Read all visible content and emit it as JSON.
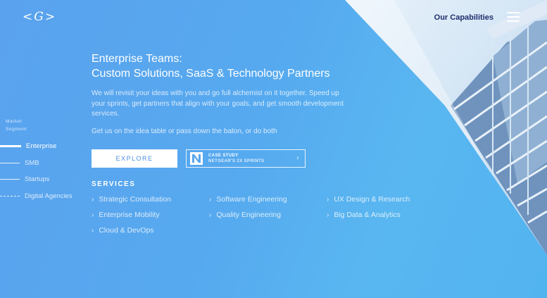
{
  "header": {
    "logo": "<G>",
    "nav_link": "Our Capabilities"
  },
  "segment_nav": {
    "label_line1": "Market",
    "label_line2": "Segment",
    "items": [
      {
        "label": "Enterprise",
        "active": true
      },
      {
        "label": "SMB",
        "active": false
      },
      {
        "label": "Startups",
        "active": false
      },
      {
        "label": "Digital Agencies",
        "active": false
      }
    ]
  },
  "hero": {
    "title_line1": "Enterprise Teams:",
    "title_line2": "Custom Solutions, SaaS & Technology Partners",
    "description": "We will revisit your ideas with you and go full alchemist on it together. Speed up your sprints, get partners that align with your goals, and get smooth development services.",
    "subtext": "Get us on the idea table or pass down the baton, or do both",
    "explore_label": "EXPLORE",
    "case_study": {
      "line1": "CASE STUDY",
      "line2": "NETGEAR'S 2X SPRINTS"
    }
  },
  "services": {
    "heading": "SERVICES",
    "items": [
      "Strategic Consultation",
      "Software Engineering",
      "UX Design & Research",
      "Enterprise Mobility",
      "Quality Engineering",
      "Big Data & Analytics",
      "Cloud & DevOps"
    ]
  },
  "icons": {
    "hamburger": "menu-icon",
    "chevron": "chevron-right-icon",
    "case_logo": "netgear-n-logo"
  },
  "colors": {
    "background": "#56a9ef",
    "nav_text": "#1d2e6c",
    "button_text": "#4d8fe0"
  }
}
